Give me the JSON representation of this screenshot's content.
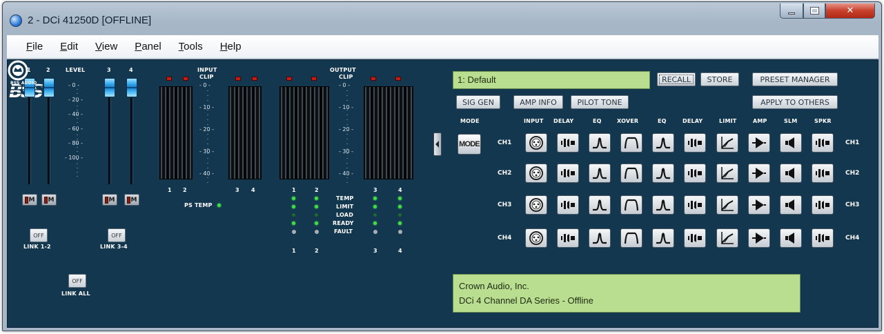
{
  "window": {
    "title": "2 - DCi 41250D [OFFLINE]"
  },
  "menu": {
    "items": [
      {
        "u": "F",
        "rest": "ile"
      },
      {
        "u": "E",
        "rest": "dit"
      },
      {
        "u": "V",
        "rest": "iew"
      },
      {
        "u": "P",
        "rest": "anel"
      },
      {
        "u": "T",
        "rest": "ools"
      },
      {
        "u": "H",
        "rest": "elp"
      }
    ]
  },
  "input_section": {
    "channel_labels": [
      "1",
      "2",
      "3",
      "4"
    ],
    "level_label": "LEVEL",
    "level_scale": [
      "- 0 -",
      "- 20 -",
      "- 40 -",
      "- 60 -",
      "- 80 -",
      "- 100 -"
    ],
    "mute_label": "M",
    "link_12": {
      "button": "OFF",
      "label": "LINK 1-2"
    },
    "link_34": {
      "button": "OFF",
      "label": "LINK 3-4"
    },
    "link_all": {
      "button": "OFF",
      "label": "LINK ALL"
    }
  },
  "input_meters": {
    "title_1": "INPUT",
    "title_2": "CLIP",
    "scale": [
      "- 0 -",
      "- 10 -",
      "- 20 -",
      "- 30 -",
      "- 40 -"
    ],
    "channel_labels": [
      "1",
      "2",
      "3",
      "4"
    ],
    "ps_temp": "PS TEMP"
  },
  "output_meters": {
    "title_1": "OUTPUT",
    "title_2": "CLIP",
    "scale": [
      "- 0 -",
      "- 10 -",
      "- 20 -",
      "- 30 -",
      "- 40 -"
    ],
    "channel_labels_top": [
      "1",
      "2",
      "3",
      "4"
    ],
    "status": [
      "TEMP",
      "LIMIT",
      "LOAD",
      "READY",
      "FAULT"
    ],
    "channel_labels_bottom": [
      "1",
      "2",
      "3",
      "4"
    ]
  },
  "preset": {
    "current": "1: Default",
    "recall": "RECALL",
    "store": "STORE",
    "preset_manager": "PRESET MANAGER",
    "apply_to_others": "APPLY TO OTHERS"
  },
  "tools": {
    "sig_gen": "SIG GEN",
    "amp_info": "AMP INFO",
    "pilot_tone": "PILOT TONE"
  },
  "matrix": {
    "mode_label": "MODE",
    "mode_button": "MODE",
    "columns": [
      "INPUT",
      "DELAY",
      "EQ",
      "XOVER",
      "EQ",
      "DELAY",
      "LIMIT",
      "AMP",
      "SLM",
      "SPKR"
    ],
    "rows": [
      "CH1",
      "CH2",
      "CH3",
      "CH4"
    ],
    "icons": [
      "xlr-input-icon",
      "delay-icon",
      "eq-icon",
      "xover-icon",
      "eq-icon",
      "delay-icon",
      "limiter-icon",
      "amp-icon",
      "slm-icon",
      "speaker-icon"
    ]
  },
  "info": {
    "line1": "Crown Audio, Inc.",
    "line2": "DCi 4 Channel DA Series - Offline"
  },
  "brand": {
    "logo_text": "BSS AUDIO"
  },
  "colors": {
    "panel_bg": "#143750",
    "lcd_bg": "#b9de90",
    "clip_led": "#c41e12",
    "status_led": "#3fe03f",
    "fader_knob": "#35a8ec"
  }
}
